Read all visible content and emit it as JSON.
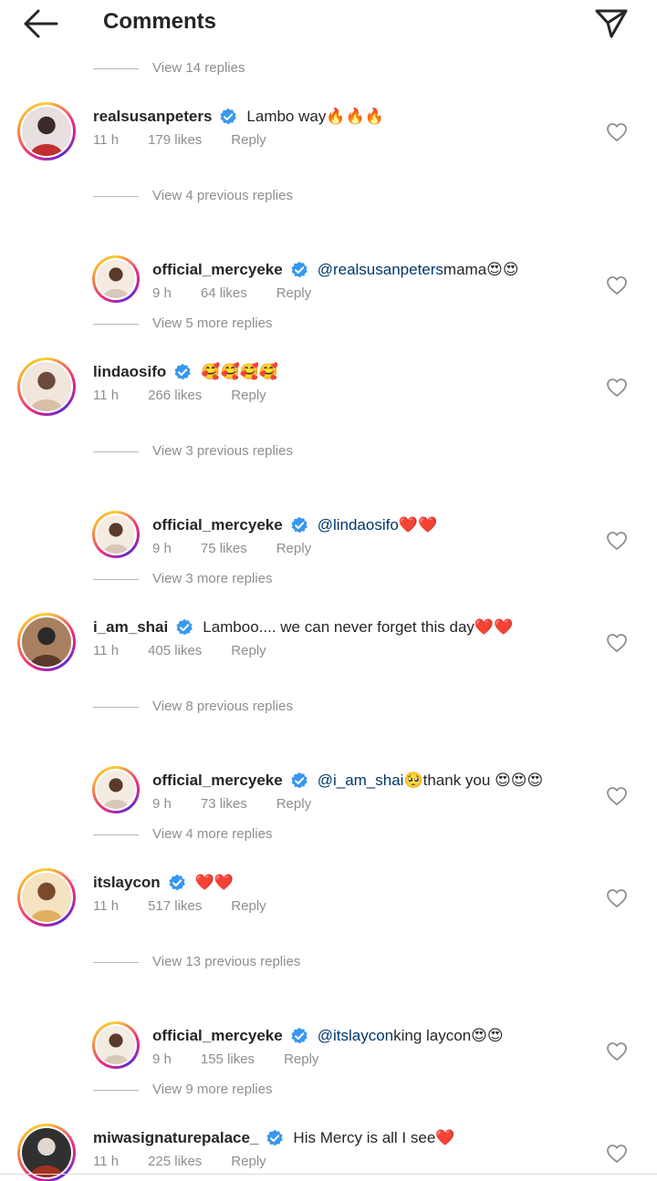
{
  "header": {
    "title": "Comments",
    "back_icon": "arrow-left-icon",
    "send_icon": "paper-plane-icon"
  },
  "colors": {
    "accent": "#3897f0",
    "mention": "#00376b",
    "muted": "#8e8e8e",
    "text": "#262626"
  },
  "items": [
    {
      "kind": "view",
      "text": "View 14 replies"
    },
    {
      "kind": "comment",
      "level": "top",
      "username": "realsusanpeters",
      "verified": true,
      "mention": "",
      "text": "Lambo way🔥🔥🔥",
      "time": "11 h",
      "likes": "179 likes",
      "reply": "Reply"
    },
    {
      "kind": "view",
      "text": "View 4 previous replies"
    },
    {
      "kind": "comment",
      "level": "reply",
      "username": "official_mercyeke",
      "verified": true,
      "mention": "@realsusanpeters",
      "text": " mama😍😍",
      "time": "9 h",
      "likes": "64 likes",
      "reply": "Reply"
    },
    {
      "kind": "view",
      "text": "View 5 more replies"
    },
    {
      "kind": "comment",
      "level": "top",
      "username": "lindaosifo",
      "verified": true,
      "mention": "",
      "text": "🥰🥰🥰🥰",
      "time": "11 h",
      "likes": "266 likes",
      "reply": "Reply"
    },
    {
      "kind": "view",
      "text": "View 3 previous replies"
    },
    {
      "kind": "comment",
      "level": "reply",
      "username": "official_mercyeke",
      "verified": true,
      "mention": "@lindaosifo",
      "text": " ❤️❤️",
      "time": "9 h",
      "likes": "75 likes",
      "reply": "Reply"
    },
    {
      "kind": "view",
      "text": "View 3 more replies"
    },
    {
      "kind": "comment",
      "level": "top",
      "username": "i_am_shai",
      "verified": true,
      "mention": "",
      "text": "Lamboo.... we can never forget this day❤️❤️",
      "time": "11 h",
      "likes": "405 likes",
      "reply": "Reply"
    },
    {
      "kind": "view",
      "text": "View 8 previous replies"
    },
    {
      "kind": "comment",
      "level": "reply",
      "username": "official_mercyeke",
      "verified": true,
      "mention": "@i_am_shai",
      "text": " 🥺thank you 😍😍😍",
      "time": "9 h",
      "likes": "73 likes",
      "reply": "Reply"
    },
    {
      "kind": "view",
      "text": "View 4 more replies"
    },
    {
      "kind": "comment",
      "level": "top",
      "username": "itslaycon",
      "verified": true,
      "mention": "",
      "text": "❤️❤️",
      "time": "11 h",
      "likes": "517 likes",
      "reply": "Reply"
    },
    {
      "kind": "view",
      "text": "View 13 previous replies"
    },
    {
      "kind": "comment",
      "level": "reply",
      "username": "official_mercyeke",
      "verified": true,
      "mention": "@itslaycon",
      "text": " king laycon😍😍",
      "time": "9 h",
      "likes": "155 likes",
      "reply": "Reply"
    },
    {
      "kind": "view",
      "text": "View 9 more replies"
    },
    {
      "kind": "comment",
      "level": "top",
      "username": "miwasignaturepalace_",
      "verified": true,
      "mention": "",
      "text": "His Mercy is all I see❤️",
      "time": "11 h",
      "likes": "225 likes",
      "reply": "Reply"
    }
  ]
}
